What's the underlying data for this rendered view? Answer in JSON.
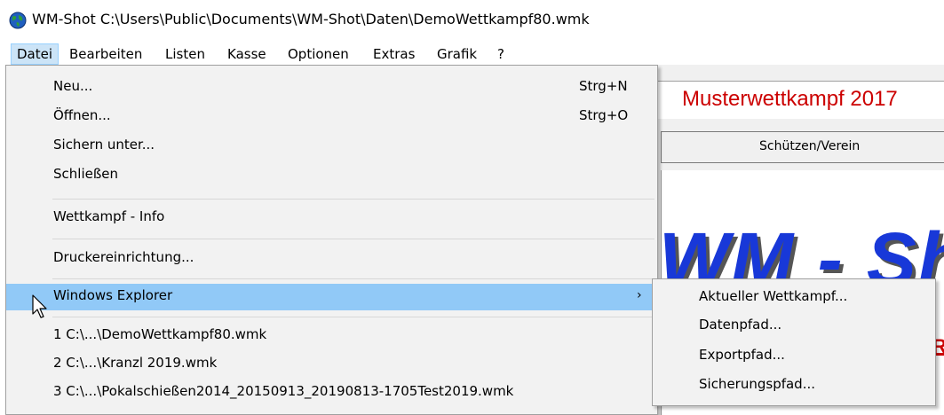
{
  "window": {
    "title": "WM-Shot C:\\Users\\Public\\Documents\\WM-Shot\\Daten\\DemoWettkampf80.wmk",
    "app_icon": "globe-icon"
  },
  "menubar": {
    "items": [
      "Datei",
      "Bearbeiten",
      "Listen",
      "Kasse",
      "Optionen",
      "Extras",
      "Grafik",
      "?"
    ],
    "active": "Datei"
  },
  "file_menu": {
    "items": [
      {
        "label": "Neu...",
        "shortcut": "Strg+N"
      },
      {
        "label": "Öffnen...",
        "shortcut": "Strg+O"
      },
      {
        "label": "Sichern unter..."
      },
      {
        "label": "Schließen"
      },
      {
        "label": "Wettkampf - Info"
      },
      {
        "label": "Druckereinrichtung..."
      },
      {
        "label": "Windows Explorer",
        "arrow": "›"
      },
      {
        "label": "1 C:\\...\\DemoWettkampf80.wmk"
      },
      {
        "label": "2 C:\\...\\Kranzl 2019.wmk"
      },
      {
        "label": "3 C:\\...\\Pokalschießen2014_20150913_20190813-1705Test2019.wmk"
      }
    ],
    "highlighted": "Windows Explorer"
  },
  "submenu": {
    "items": [
      "Aktueller Wettkampf...",
      "Datenpfad...",
      "Exportpfad...",
      "Sicherungspfad..."
    ]
  },
  "background_app": {
    "competition_title": "Musterwettkampf 2017",
    "tab": "Schützen/Verein",
    "logo_text": "WM - Shot",
    "partial_red_text": "R"
  },
  "colors": {
    "menu_highlight": "#91c9f7",
    "menubar_active": "#cce4f7",
    "title_red": "#cc0000",
    "logo_blue": "#1838d8"
  }
}
